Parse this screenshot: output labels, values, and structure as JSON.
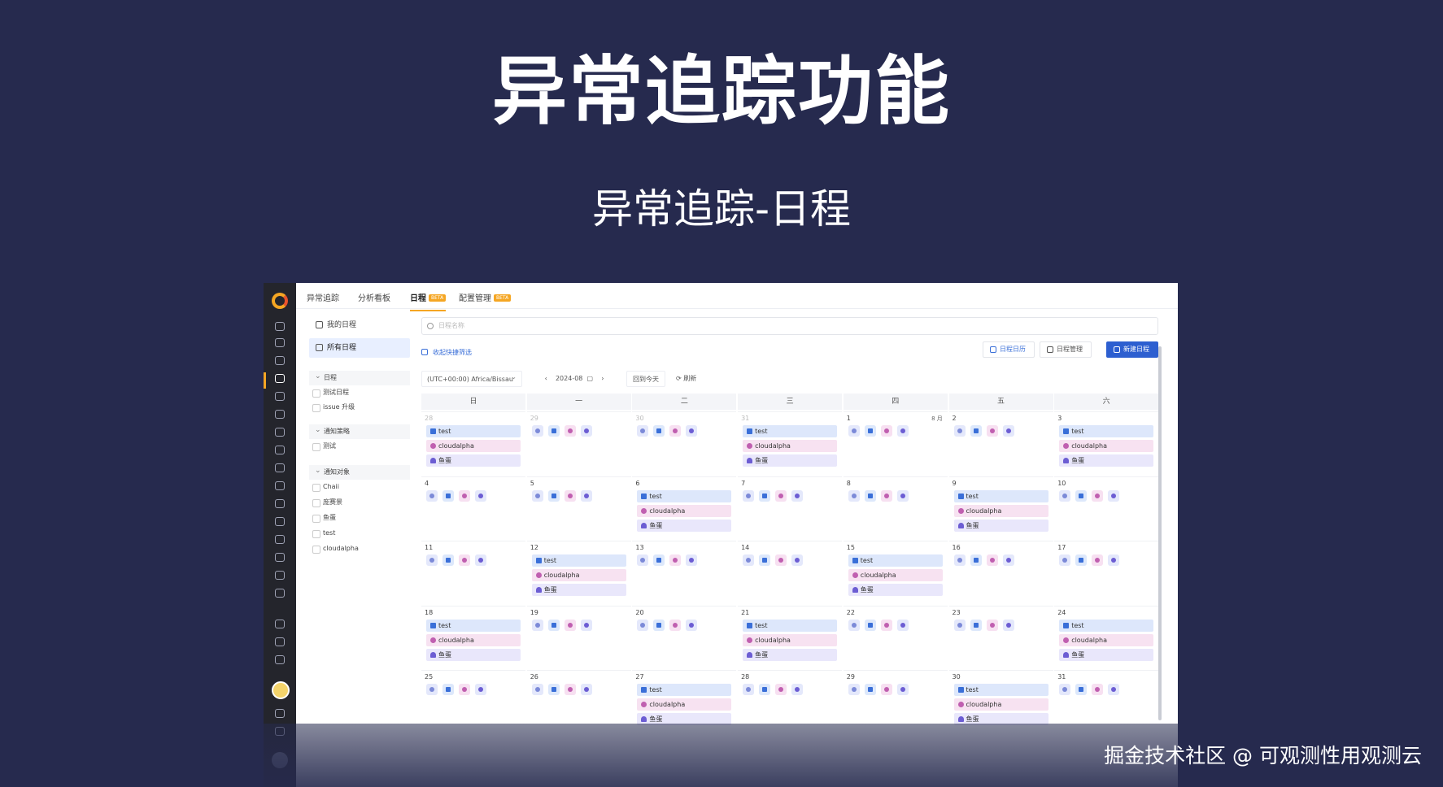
{
  "slide": {
    "title": "异常追踪功能",
    "subtitle": "异常追踪-日程",
    "watermark": "掘金技术社区 @ 可观测性用观测云"
  },
  "colors": {
    "background": "#262a4e",
    "accent": "#f5a623",
    "primary": "#2d5fd0"
  },
  "nav": {
    "tabs": [
      {
        "label": "异常追踪",
        "active": false,
        "badge": ""
      },
      {
        "label": "分析看板",
        "active": false,
        "badge": ""
      },
      {
        "label": "日程",
        "active": true,
        "badge": "BETA"
      },
      {
        "label": "配置管理",
        "active": false,
        "badge": "BETA"
      }
    ]
  },
  "sidebar": {
    "my_schedule": "我的日程",
    "all_schedule": "所有日程",
    "groups": [
      {
        "label": "日程",
        "items": [
          "测试日程",
          "issue 升级"
        ]
      },
      {
        "label": "通知策略",
        "items": [
          "测试"
        ]
      },
      {
        "label": "通知对象",
        "items": [
          "Chaii",
          "庞赛景",
          "鱼蛋",
          "test",
          "cloudalpha"
        ]
      }
    ]
  },
  "main": {
    "search_placeholder": "日程名称",
    "filter_link": "收起快捷筛选",
    "btn_calendar": "日程日历",
    "btn_manage": "日程管理",
    "btn_new": "新建日程",
    "timezone": "(UTC+00:00) Africa/Bissau",
    "month": "2024-08",
    "btn_today": "回到今天",
    "btn_refresh": "刷新"
  },
  "calendar": {
    "weekdays": [
      "日",
      "一",
      "二",
      "三",
      "四",
      "五",
      "六"
    ],
    "month_label": "8 月",
    "event_labels": {
      "test": "test",
      "cloud": "cloudalpha",
      "fish": "鱼蛋"
    },
    "days": [
      {
        "d": "28",
        "dim": true,
        "full": true
      },
      {
        "d": "29",
        "dim": true,
        "full": false
      },
      {
        "d": "30",
        "dim": true,
        "full": false
      },
      {
        "d": "31",
        "dim": true,
        "full": true
      },
      {
        "d": "1",
        "dim": false,
        "full": false,
        "month": true
      },
      {
        "d": "2",
        "dim": false,
        "full": false
      },
      {
        "d": "3",
        "dim": false,
        "full": true
      },
      {
        "d": "4",
        "dim": false,
        "full": false
      },
      {
        "d": "5",
        "dim": false,
        "full": false
      },
      {
        "d": "6",
        "dim": false,
        "full": true
      },
      {
        "d": "7",
        "dim": false,
        "full": false
      },
      {
        "d": "8",
        "dim": false,
        "full": false
      },
      {
        "d": "9",
        "dim": false,
        "full": true
      },
      {
        "d": "10",
        "dim": false,
        "full": false
      },
      {
        "d": "11",
        "dim": false,
        "full": false
      },
      {
        "d": "12",
        "dim": false,
        "full": true
      },
      {
        "d": "13",
        "dim": false,
        "full": false
      },
      {
        "d": "14",
        "dim": false,
        "full": false
      },
      {
        "d": "15",
        "dim": false,
        "full": true
      },
      {
        "d": "16",
        "dim": false,
        "full": false
      },
      {
        "d": "17",
        "dim": false,
        "full": false
      },
      {
        "d": "18",
        "dim": false,
        "full": true
      },
      {
        "d": "19",
        "dim": false,
        "full": false
      },
      {
        "d": "20",
        "dim": false,
        "full": false
      },
      {
        "d": "21",
        "dim": false,
        "full": true
      },
      {
        "d": "22",
        "dim": false,
        "full": false
      },
      {
        "d": "23",
        "dim": false,
        "full": false
      },
      {
        "d": "24",
        "dim": false,
        "full": true
      },
      {
        "d": "25",
        "dim": false,
        "full": false
      },
      {
        "d": "26",
        "dim": false,
        "full": false
      },
      {
        "d": "27",
        "dim": false,
        "full": true
      },
      {
        "d": "28",
        "dim": false,
        "full": false
      },
      {
        "d": "29",
        "dim": false,
        "full": false
      },
      {
        "d": "30",
        "dim": false,
        "full": true
      },
      {
        "d": "31",
        "dim": false,
        "full": false
      }
    ]
  }
}
